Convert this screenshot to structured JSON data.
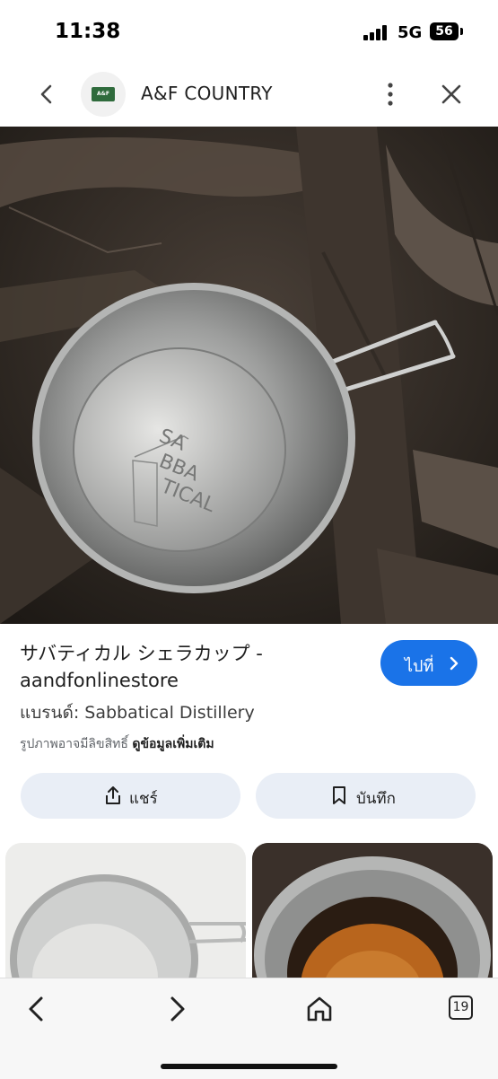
{
  "status_bar": {
    "time": "11:38",
    "network": "5G",
    "battery": "56"
  },
  "header": {
    "site_logo_text": "A&F",
    "site_name": "A&F COUNTRY",
    "icons": [
      "chevron-left-icon",
      "more-vertical-icon",
      "close-icon"
    ]
  },
  "product": {
    "title_line1": "サバティカル シェラカップ -",
    "title_line2": "aandfonlinestore",
    "brand": "แบรนด์: Sabbatical Distillery",
    "copyright_note": "รูปภาพอาจมีลิขสิทธิ์",
    "more_info": "ดูข้อมูลเพิ่มเติม",
    "image_engraving": [
      "SA",
      "BBA",
      "TICAL"
    ]
  },
  "actions": {
    "visit_label": "ไปที่",
    "share_label": "แชร์",
    "save_label": "บันทึก"
  },
  "toolbar": {
    "tab_count": "19",
    "icons": [
      "back-icon",
      "forward-icon",
      "home-icon",
      "tabs-icon"
    ]
  },
  "colors": {
    "accent": "#1a73e8",
    "pill_bg": "#e9eef6"
  }
}
